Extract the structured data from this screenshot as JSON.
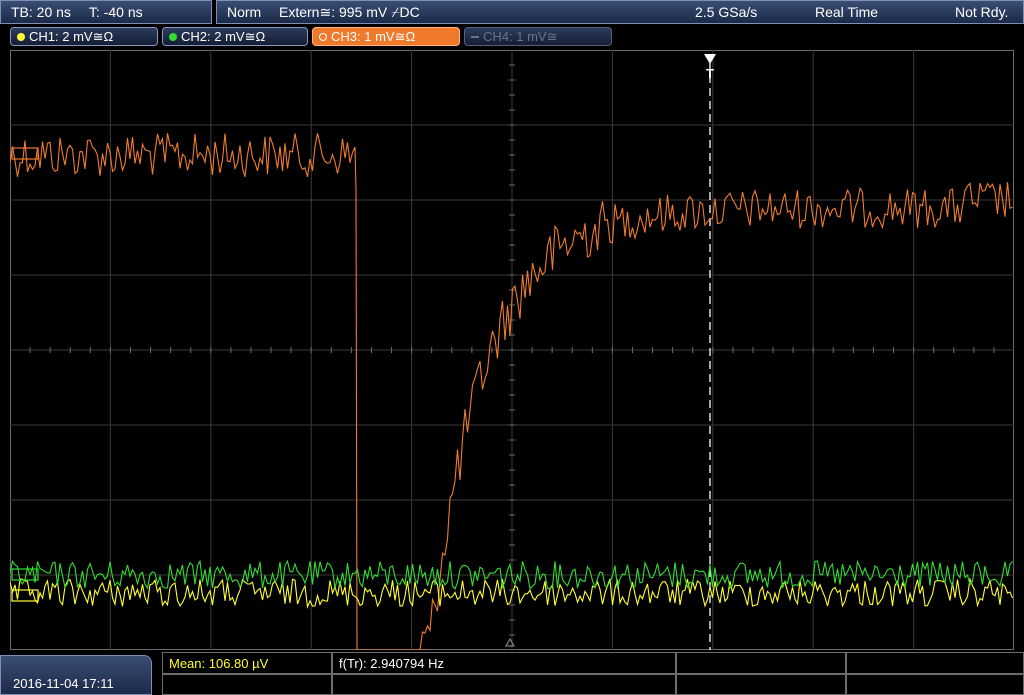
{
  "status_bar": {
    "timebase": "TB: 20 ns",
    "trigger_time": "T: -40 ns",
    "acq_mode": "Norm",
    "trigger_source": "Extern≅: 995 mV ⌿DC",
    "sample_rate": "2.5 GSa/s",
    "mode": "Real Time",
    "state": "Not Rdy."
  },
  "channels": [
    {
      "label": "CH1: 2 mV≅Ω",
      "color": "#ffff33",
      "active": false
    },
    {
      "label": "CH2: 2 mV≅Ω",
      "color": "#33dd33",
      "active": false
    },
    {
      "label": "CH3: 1 mV≅Ω",
      "color": "#f07c30",
      "active": true
    },
    {
      "label": "CH4: 1 mV≅",
      "color": "#6a7388",
      "active": false
    }
  ],
  "marker_labels": {
    "trigger": "T"
  },
  "footer": {
    "datetime": "2016-11-04 17:11",
    "mean": "Mean: 106.80 µV",
    "frequency": "f(Tr): 2.940794 Hz"
  },
  "colors": {
    "ch1": "#ffff33",
    "ch2": "#33dd33",
    "ch3": "#f07c30",
    "grid": "#3c3c3c"
  }
}
